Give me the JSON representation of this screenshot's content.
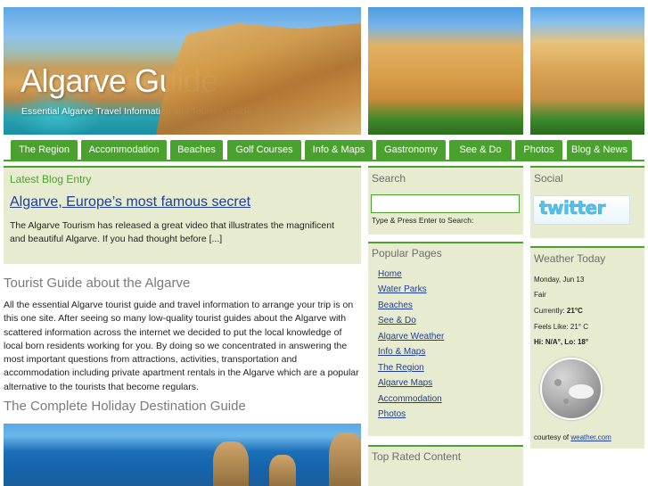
{
  "header": {
    "title": "Algarve Guide",
    "tagline": "Essential Algarve Travel Information and Tourism Guide"
  },
  "nav": {
    "items": [
      "The Region",
      "Accommodation",
      "Beaches",
      "Golf Courses",
      "Info & Maps",
      "Gastronomy",
      "See & Do",
      "Photos",
      "Blog & News"
    ]
  },
  "blog": {
    "heading": "Latest Blog Entry",
    "link": "Algarve, Europe’s most famous secret",
    "excerpt": "The Algarve Tourism has released a great video that illustrates the magnificent and beautiful Algarve. If you had thought before [...]"
  },
  "main": {
    "heading1": "Tourist Guide about the Algarve",
    "paragraph1": "All the essential Algarve tourist guide and travel information to arrange your trip is on this one site. After seeing so many low-quality tourist guides about the Algarve with scattered information across the internet we decided to put the local knowledge of local born residents working for you. By doing so we concentrated in answering the most important questions from attractions, activities, transportation and accommodation including private apartment rentals in the Algarve which are a popular alternative to the tourists that become regulars.",
    "heading2": "The Complete Holiday Destination Guide"
  },
  "search": {
    "title": "Search",
    "value": "",
    "hint": "Type & Press Enter to Search:"
  },
  "popular": {
    "title": "Popular Pages",
    "links": [
      "Home",
      "Water Parks",
      "Beaches",
      "See & Do",
      "Algarve Weather",
      "Info & Maps",
      "The Region",
      "Algarve Maps",
      "Accommodation",
      "Photos"
    ]
  },
  "top_rated": {
    "title": "Top Rated Content"
  },
  "social": {
    "title": "Social",
    "twitter": "twitter"
  },
  "weather": {
    "title": "Weather Today",
    "date": "Monday, Jun 13",
    "condition": "Fair",
    "currently_label": "Currently:",
    "currently_value": "21°C",
    "feels_like": "Feels Like: 21° C",
    "hi_lo": "Hi: N/A°, Lo: 18°",
    "courtesy_label": "courtesy of",
    "courtesy_link": "weather.com"
  },
  "colors": {
    "nav_green": "#4aa22e",
    "box_bg": "#e7ebd0",
    "link_blue": "#1f3d9a"
  }
}
